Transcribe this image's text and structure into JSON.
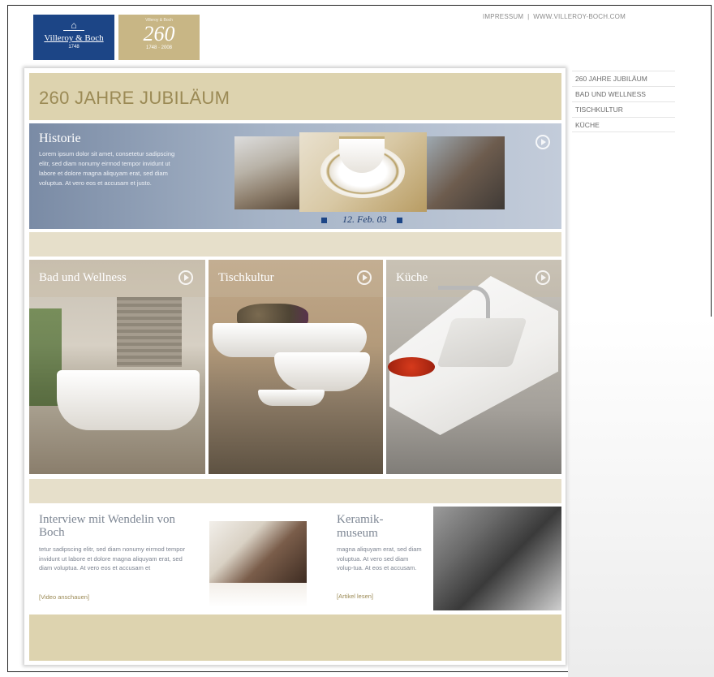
{
  "header": {
    "logo_brand": "Villeroy & Boch",
    "logo_brand_year": "1748",
    "logo_jubilee_number": "260",
    "logo_jubilee_years": "1748 · 2008",
    "link_impressum": "IMPRESSUM",
    "link_separator": "|",
    "link_website": "WWW.VILLEROY-BOCH.COM"
  },
  "nav": {
    "items": [
      "260 JAHRE JUBILÄUM",
      "BAD UND WELLNESS",
      "TISCHKULTUR",
      "KÜCHE"
    ]
  },
  "page": {
    "title": "260 JAHRE JUBILÄUM"
  },
  "historie": {
    "heading": "Historie",
    "text": "Lorem ipsum dolor sit amet, consetetur sadipscing elitr, sed diam nonumy eirmod tempor invidunt ut labore et dolore magna aliquyam erat, sed diam voluptua. At vero eos et accusam et justo.",
    "date": "12. Feb. 03"
  },
  "tiles": [
    {
      "label": "Bad und Wellness"
    },
    {
      "label": "Tischkultur"
    },
    {
      "label": "Küche"
    }
  ],
  "features": {
    "interview": {
      "heading": "Interview mit Wendelin von Boch",
      "text": "tetur sadipscing elitr, sed diam nonumy eirmod tempor invidunt ut labore et dolore magna aliquyam erat, sed diam voluptua. At vero eos et accusam et",
      "link": "[Video anschauen]"
    },
    "museum": {
      "heading_line1": "Keramik-",
      "heading_line2": "museum",
      "text": "magna aliquyam erat, sed diam voluptua. At vero sed diam volup-tua. At eos et accusam.",
      "link": "[Artikel lesen]"
    }
  },
  "colors": {
    "brand_blue": "#1c4586",
    "gold": "#c8b685",
    "band": "#ddd3af",
    "title_text": "#9b8a55"
  }
}
